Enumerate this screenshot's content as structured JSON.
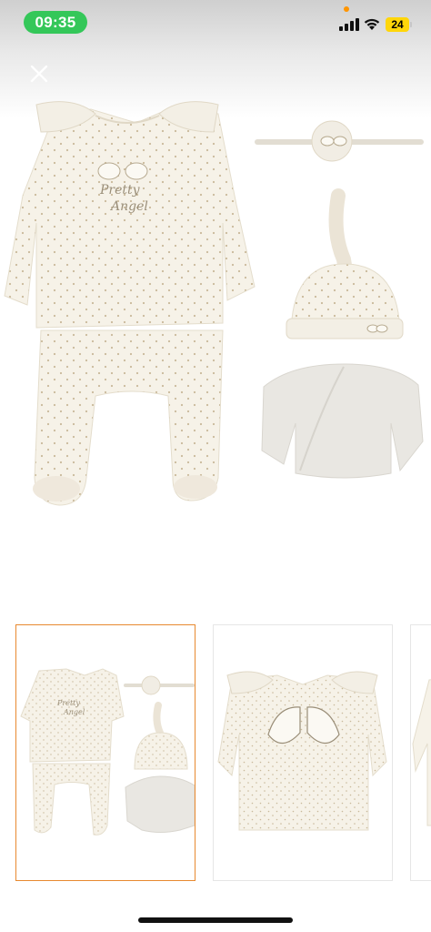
{
  "status_bar": {
    "time": "09:35",
    "battery_level": "24",
    "icons": [
      "signal-icon",
      "wifi-icon",
      "battery-icon"
    ]
  },
  "header": {
    "close_icon": "close-icon"
  },
  "main_image": {
    "garment_text_line1": "Pretty",
    "garment_text_line2": "Angel"
  },
  "thumbnails": {
    "selected_index": 0,
    "items": [
      {
        "name": "set-front",
        "text_line1": "Pretty",
        "text_line2": "Angel"
      },
      {
        "name": "top-back"
      },
      {
        "name": "partial-next"
      }
    ]
  },
  "colors": {
    "accent_selected_border": "#e8892f",
    "time_pill": "#34c759",
    "battery": "#ffd60a",
    "garment_cream": "#f6f2e8",
    "garment_dot": "#c9b99a",
    "garment_grey": "#e7e5e1"
  }
}
